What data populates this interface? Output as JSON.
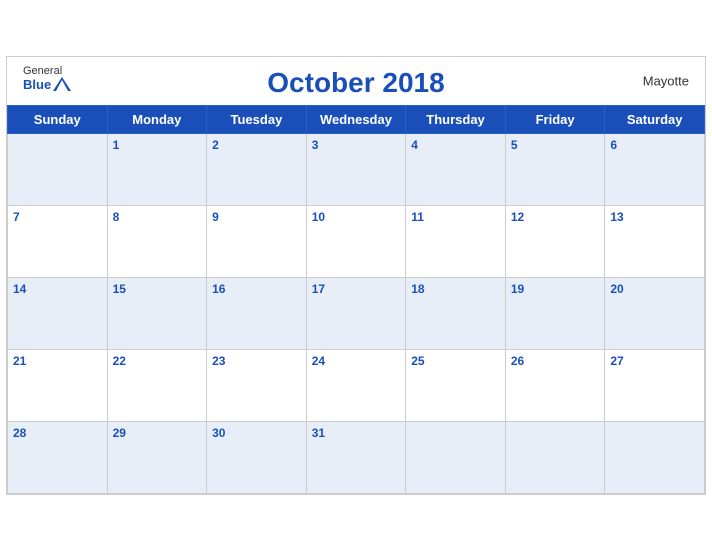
{
  "header": {
    "logo_general": "General",
    "logo_blue": "Blue",
    "title": "October 2018",
    "region": "Mayotte"
  },
  "weekdays": [
    "Sunday",
    "Monday",
    "Tuesday",
    "Wednesday",
    "Thursday",
    "Friday",
    "Saturday"
  ],
  "weeks": [
    [
      null,
      1,
      2,
      3,
      4,
      5,
      6
    ],
    [
      7,
      8,
      9,
      10,
      11,
      12,
      13
    ],
    [
      14,
      15,
      16,
      17,
      18,
      19,
      20
    ],
    [
      21,
      22,
      23,
      24,
      25,
      26,
      27
    ],
    [
      28,
      29,
      30,
      31,
      null,
      null,
      null
    ]
  ]
}
